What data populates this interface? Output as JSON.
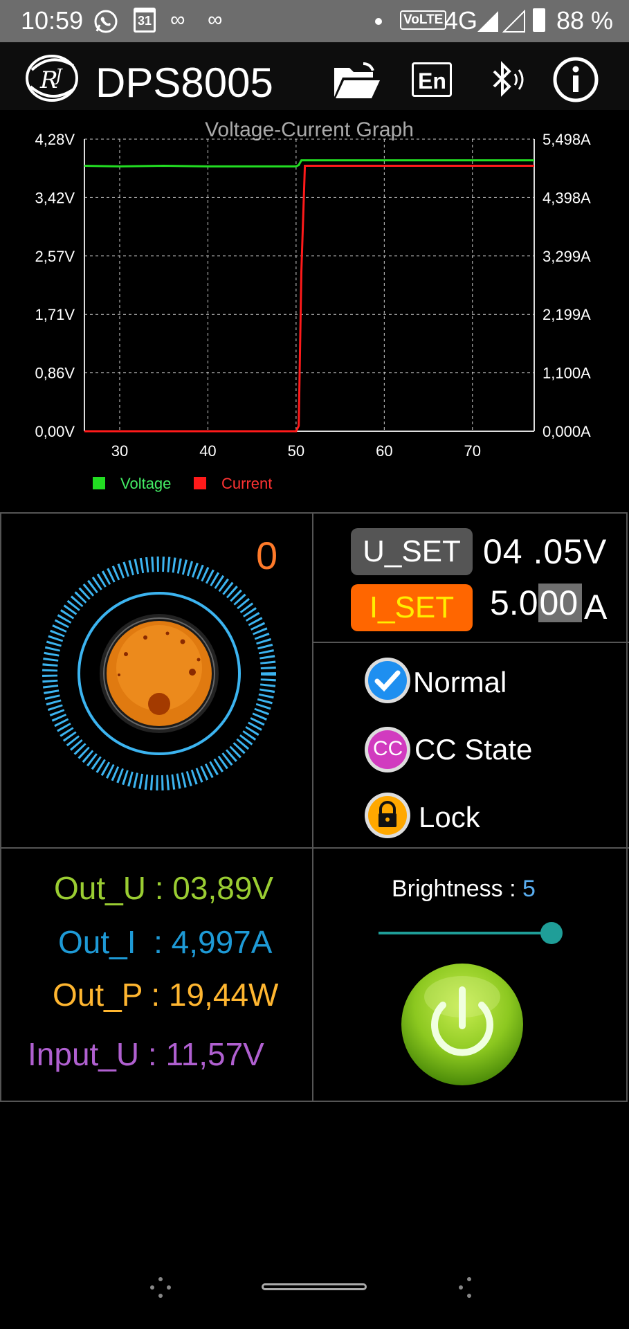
{
  "status_bar": {
    "time": "10:59",
    "whatsapp_icon": "whatsapp-icon",
    "calendar_day": "31",
    "volte": "VoLTE",
    "network": "4G",
    "battery_percent": "88 %"
  },
  "app_bar": {
    "title": "DPS8005",
    "icons": [
      "open-folder-icon",
      "language-en-icon",
      "bluetooth-icon",
      "info-icon"
    ],
    "language_label": "En"
  },
  "chart_data": {
    "type": "line",
    "title": "Voltage-Current Graph",
    "x": [
      26,
      30,
      35,
      40,
      45,
      50,
      50.3,
      50.6,
      51,
      55,
      60,
      65,
      70,
      75,
      77
    ],
    "series": [
      {
        "name": "Voltage",
        "color": "#22dd22",
        "axis": "left",
        "values": [
          3.89,
          3.88,
          3.89,
          3.88,
          3.88,
          3.88,
          3.9,
          3.97,
          3.97,
          3.97,
          3.97,
          3.97,
          3.97,
          3.97,
          3.97
        ]
      },
      {
        "name": "Current",
        "color": "#ff1a1a",
        "axis": "right",
        "values": [
          0,
          0,
          0,
          0,
          0,
          0,
          0.1,
          3.0,
          4.997,
          4.997,
          4.997,
          4.997,
          4.997,
          4.997,
          4.997
        ]
      }
    ],
    "xlim": [
      26,
      77
    ],
    "x_ticks": [
      "30",
      "40",
      "50",
      "60",
      "70"
    ],
    "x_tick_values": [
      30,
      40,
      50,
      60,
      70
    ],
    "ylim_left": [
      0,
      4.28
    ],
    "ylim_right": [
      0,
      5.498
    ],
    "y_left_ticks": [
      "4,28V",
      "3,42V",
      "2,57V",
      "1,71V",
      "0,86V",
      "0,00V"
    ],
    "y_right_ticks": [
      "5,498A",
      "4,398A",
      "3,299A",
      "2,199A",
      "1,100A",
      "0,000A"
    ],
    "grid": true,
    "legend_position": "bottom-left"
  },
  "knob": {
    "counter": "0"
  },
  "settings": {
    "u_set_label": "U_SET",
    "u_set_value": "04 .05",
    "u_set_unit": "V",
    "i_set_label": "I_SET",
    "i_set_value_a": "5.0",
    "i_set_value_b": "00",
    "i_set_unit": "A"
  },
  "modes": {
    "normal": "Normal",
    "cc_state_badge": "CC",
    "cc_state": "CC State",
    "lock": "Lock",
    "normal_checked": true
  },
  "readouts": {
    "out_u": "Out_U : 03,89V",
    "out_i": "Out_I  : 4,997A",
    "out_p": "Out_P : 19,44W",
    "input_u": "Input_U : 11,57V"
  },
  "brightness": {
    "label": "Brightness :",
    "value": "5",
    "level_fraction": 1.0
  },
  "colors": {
    "u_set_bg": "#555555",
    "i_set_bg": "#ff6600",
    "i_set_text": "#ffee00",
    "out_u": "#9acd32",
    "out_i": "#1e9ad6",
    "out_p": "#ffb630",
    "input_u": "#b060d0",
    "knob_ring": "#3cb4f0",
    "power_green": "#8cc820",
    "counter": "#ff7a2a"
  }
}
